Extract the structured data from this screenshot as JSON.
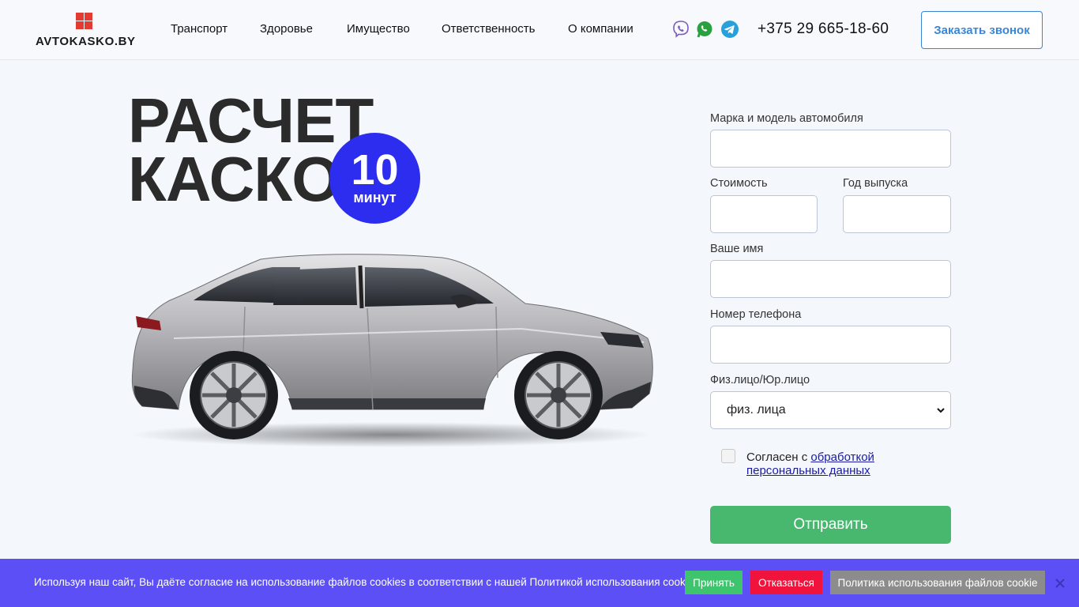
{
  "header": {
    "logo_text": "AVTOKASKO.BY",
    "nav": [
      "Транспорт",
      "Здоровье",
      "Имущество",
      "Ответственность",
      "О компании"
    ],
    "messengers": [
      "viber-icon",
      "whatsapp-icon",
      "telegram-icon"
    ],
    "phone": "+375 29 665-18-60",
    "call_button": "Заказать звонок"
  },
  "hero": {
    "title_line1": "РАСЧЕТ",
    "title_line2": "КАСКО",
    "badge_number": "10",
    "badge_unit": "минут"
  },
  "form": {
    "car_model_label": "Марка и модель автомобиля",
    "car_model_value": "",
    "cost_label": "Стоимость",
    "cost_value": "",
    "year_label": "Год выпуска",
    "year_value": "",
    "name_label": "Ваше имя",
    "name_value": "",
    "phone_label": "Номер телефона",
    "phone_value": "",
    "type_label": "Физ.лицо/Юр.лицо",
    "type_selected": "физ. лица",
    "agree_prefix": "Согласен с ",
    "agree_link": "обработкой персональных данных",
    "submit": "Отправить"
  },
  "cookie": {
    "text": "Используя наш сайт, Вы даёте согласие на использование файлов cookies в соответствии с нашей Политикой использования cookies.",
    "accept": "Принять",
    "decline": "Отказаться",
    "policy": "Политика использования файлов cookie"
  },
  "colors": {
    "accent_blue": "#3a86d6",
    "badge": "#2d2df0",
    "submit_green": "#47b86e",
    "cookie_bar": "#5b4ff5",
    "accept_green": "#3ec46d",
    "decline_red": "#f0143c",
    "policy_gray": "#8c8c8c",
    "logo_red": "#e23b32"
  }
}
